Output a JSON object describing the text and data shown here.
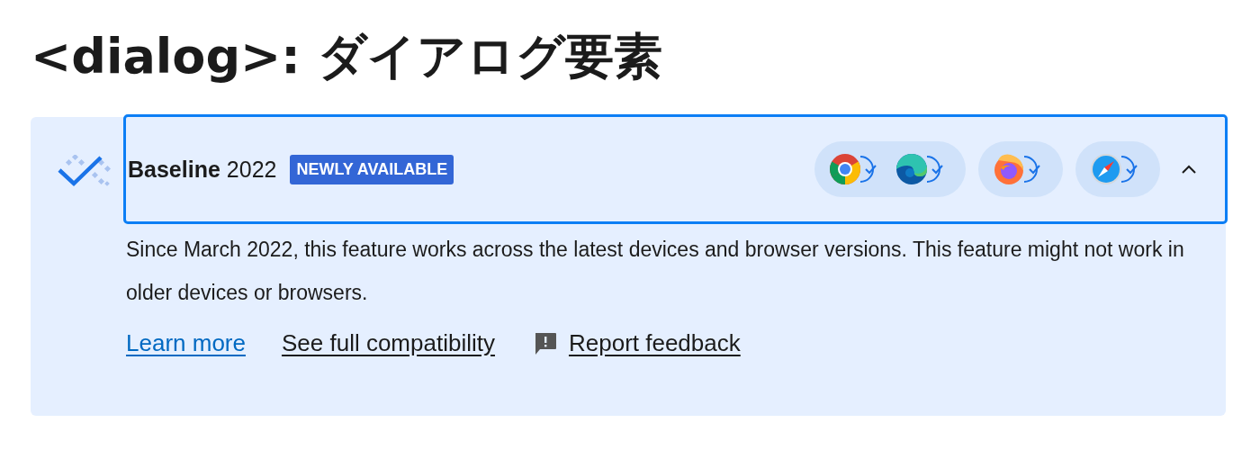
{
  "heading": "<dialog>: ダイアログ要素",
  "baseline": {
    "label": "Baseline",
    "year": "2022",
    "badge": "NEWLY AVAILABLE",
    "expanded": true,
    "browser_groups": [
      {
        "browsers": [
          {
            "kind": "chrome",
            "supported": true
          },
          {
            "kind": "edge",
            "supported": true
          }
        ]
      },
      {
        "browsers": [
          {
            "kind": "firefox",
            "supported": true
          }
        ]
      },
      {
        "browsers": [
          {
            "kind": "safari",
            "supported": true
          }
        ]
      }
    ],
    "description": "Since March 2022, this feature works across the latest devices and browser versions. This feature might not work in older devices or browsers.",
    "links": [
      {
        "kind": "learn",
        "text": "Learn more"
      },
      {
        "kind": "compat",
        "text": "See full compatibility"
      },
      {
        "kind": "feedback",
        "text": "Report feedback"
      }
    ]
  }
}
